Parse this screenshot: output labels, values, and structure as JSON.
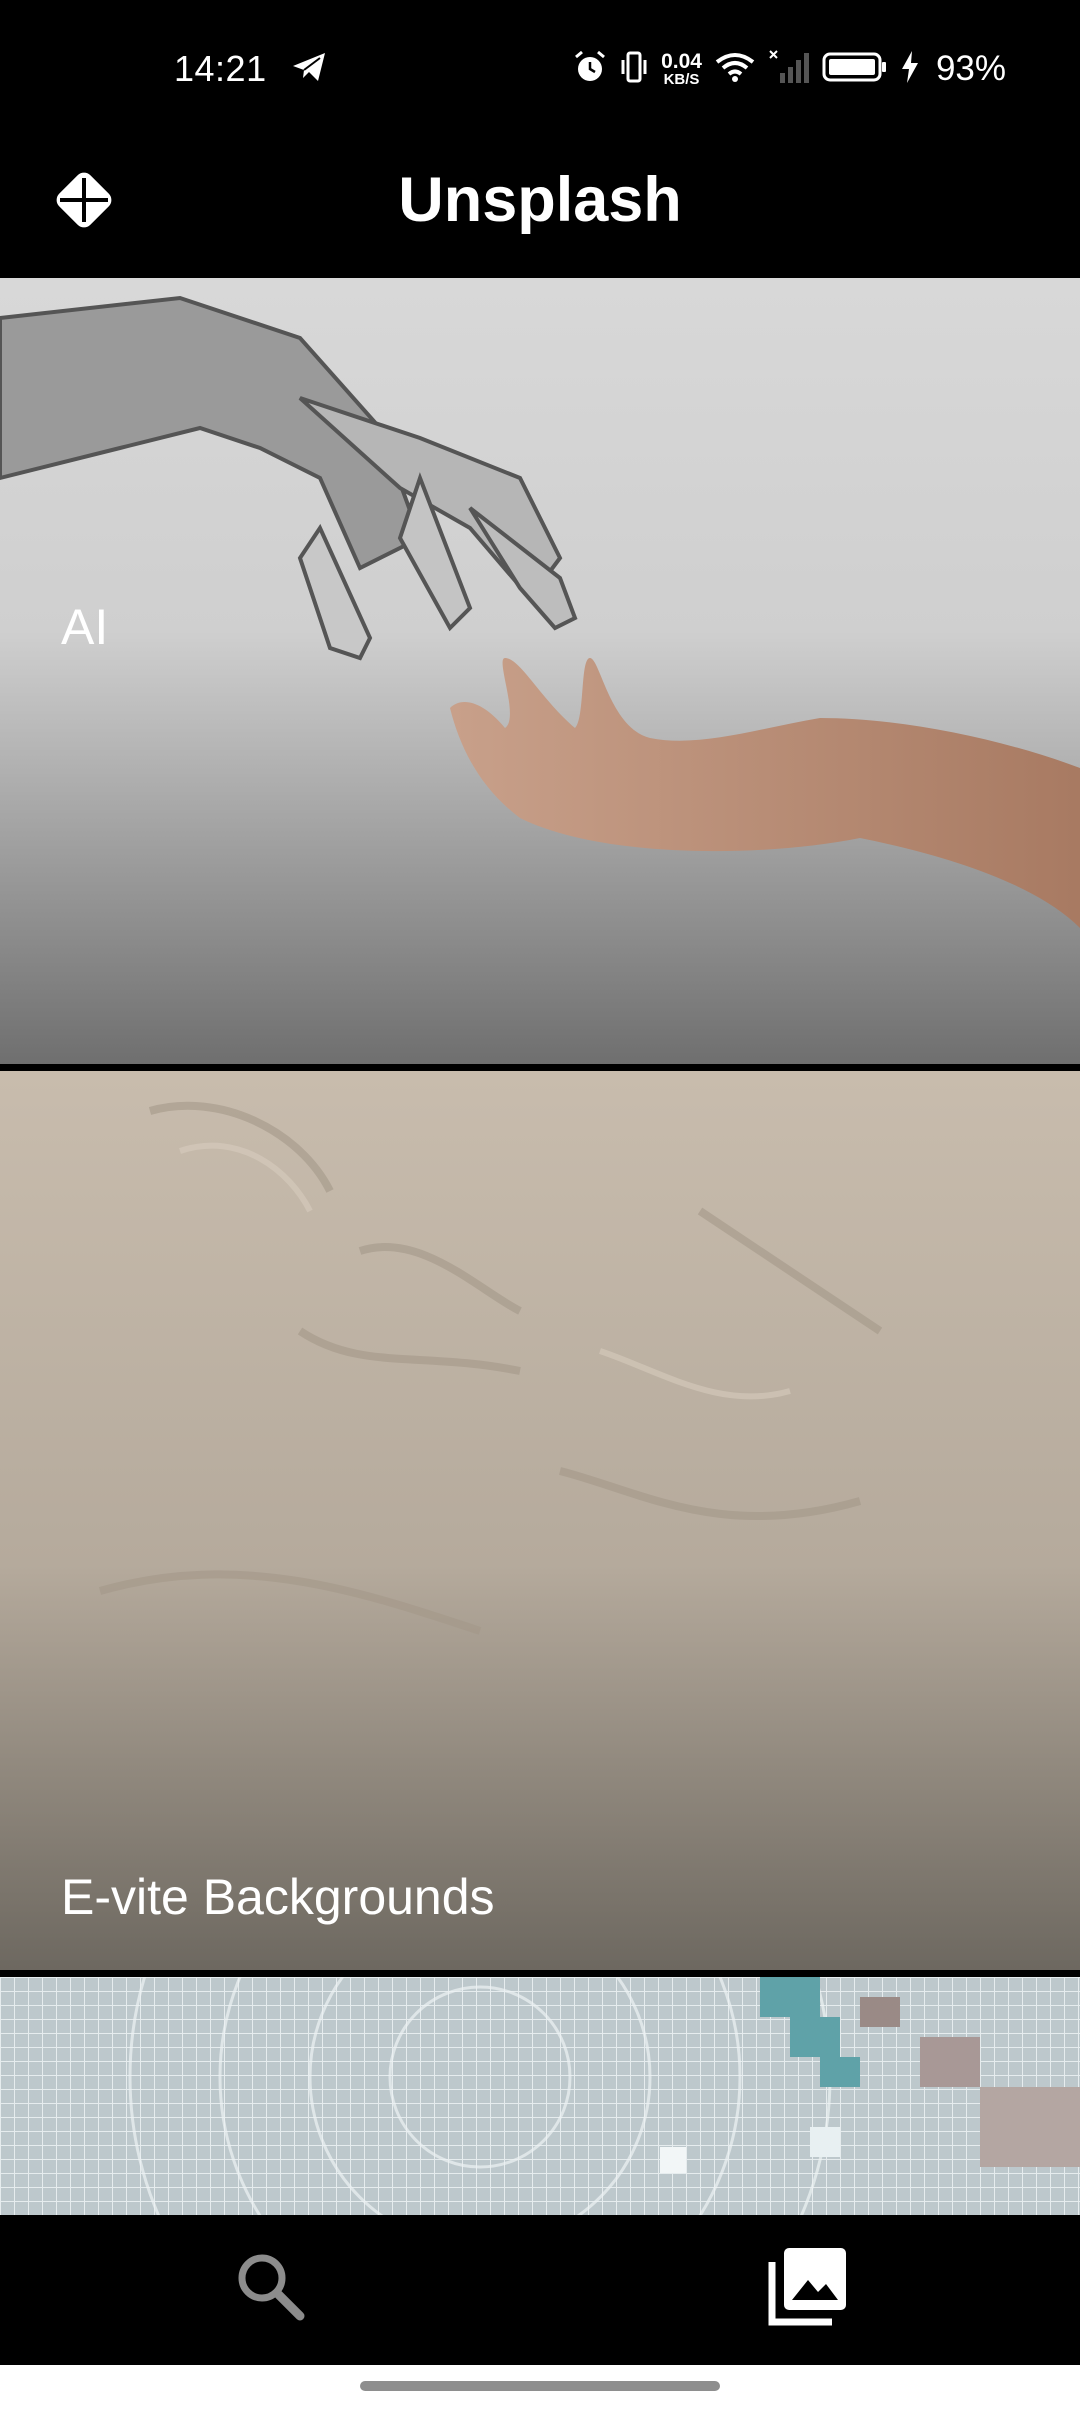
{
  "status_bar": {
    "time": "14:21",
    "netspeed_value": "0.04",
    "netspeed_unit": "KB/S",
    "battery_percent": "93%",
    "icons": [
      "telegram-icon",
      "alarm-icon",
      "vibrate-icon",
      "wifi-icon",
      "signal-icon",
      "battery-icon",
      "charging-icon"
    ]
  },
  "app_bar": {
    "title": "Unsplash",
    "logo_icon": "unsplash-logo-icon"
  },
  "collections": [
    {
      "label": "AI"
    },
    {
      "label": "E-vite Backgrounds"
    },
    {
      "label": ""
    }
  ],
  "bottom_nav": {
    "items": [
      {
        "icon": "search-icon"
      },
      {
        "icon": "collections-icon"
      }
    ]
  },
  "colors": {
    "background": "#000000",
    "text": "#ffffff",
    "gesture_bar": "#8e8e8e"
  }
}
